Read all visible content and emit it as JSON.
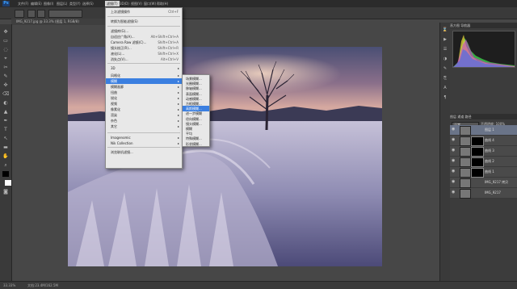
{
  "app": {
    "logo": "Ps"
  },
  "menubar": {
    "items": [
      "文件(F)",
      "编辑(E)",
      "图像(I)",
      "图层(L)",
      "类型(Y)",
      "选择(S)",
      "滤镜(T)",
      "3D(D)",
      "视图(V)",
      "窗口(W)",
      "帮助(H)"
    ]
  },
  "doc_tab": {
    "title": "IMG_9217.jpg @ 33.3% (图层 1, RGB/8)"
  },
  "filter_menu": {
    "items": [
      {
        "label": "上次滤镜操作",
        "shortcut": "Ctrl+F",
        "arrow": false
      },
      {
        "label": "转换为智能滤镜(S)",
        "shortcut": "",
        "arrow": false
      },
      {
        "label": "滤镜库(G)...",
        "shortcut": "",
        "arrow": false
      },
      {
        "label": "自适应广角(A)...",
        "shortcut": "Alt+Shift+Ctrl+A",
        "arrow": false
      },
      {
        "label": "Camera Raw 滤镜(C)...",
        "shortcut": "Shift+Ctrl+A",
        "arrow": false
      },
      {
        "label": "镜头校正(R)...",
        "shortcut": "Shift+Ctrl+R",
        "arrow": false
      },
      {
        "label": "液化(L)...",
        "shortcut": "Shift+Ctrl+X",
        "arrow": false
      },
      {
        "label": "消失点(V)...",
        "shortcut": "Alt+Ctrl+V",
        "arrow": false
      },
      {
        "label": "3D",
        "shortcut": "",
        "arrow": true
      },
      {
        "label": "风格化",
        "shortcut": "",
        "arrow": true
      },
      {
        "label": "模糊",
        "shortcut": "",
        "arrow": true
      },
      {
        "label": "模糊画廊",
        "shortcut": "",
        "arrow": true
      },
      {
        "label": "扭曲",
        "shortcut": "",
        "arrow": true
      },
      {
        "label": "锐化",
        "shortcut": "",
        "arrow": true
      },
      {
        "label": "视频",
        "shortcut": "",
        "arrow": true
      },
      {
        "label": "像素化",
        "shortcut": "",
        "arrow": true
      },
      {
        "label": "渲染",
        "shortcut": "",
        "arrow": true
      },
      {
        "label": "杂色",
        "shortcut": "",
        "arrow": true
      },
      {
        "label": "其它",
        "shortcut": "",
        "arrow": true
      },
      {
        "label": "Imagenomic",
        "shortcut": "",
        "arrow": true
      },
      {
        "label": "Nik Collection",
        "shortcut": "",
        "arrow": true
      },
      {
        "label": "浏览联机滤镜...",
        "shortcut": "",
        "arrow": false
      }
    ]
  },
  "blur_submenu": {
    "items": [
      "场景模糊...",
      "光圈模糊...",
      "移轴模糊...",
      "表面模糊...",
      "动感模糊...",
      "方框模糊...",
      "高斯模糊...",
      "进一步模糊",
      "径向模糊...",
      "镜头模糊...",
      "模糊",
      "平均",
      "特殊模糊...",
      "形状模糊..."
    ]
  },
  "right_panel": {
    "top_tabs": "直方图  导航器",
    "mid_tabs": "图层  通道  路径",
    "blend_mode": "正常",
    "opacity": "不透明度: 100%",
    "fill": "填充: 100%",
    "layers": [
      {
        "name": "图层 1",
        "mask": false,
        "selected": true
      },
      {
        "name": "曲线 4",
        "mask": true,
        "selected": false
      },
      {
        "name": "曲线 3",
        "mask": true,
        "selected": false
      },
      {
        "name": "曲线 2",
        "mask": true,
        "selected": false
      },
      {
        "name": "曲线 1",
        "mask": true,
        "selected": false
      },
      {
        "name": "IMG_9217 拷贝",
        "mask": false,
        "selected": false
      },
      {
        "name": "IMG_9217",
        "mask": false,
        "selected": false
      }
    ]
  },
  "status": {
    "zoom": "33.33%",
    "doc": "文档:23.4M/162.5M"
  }
}
